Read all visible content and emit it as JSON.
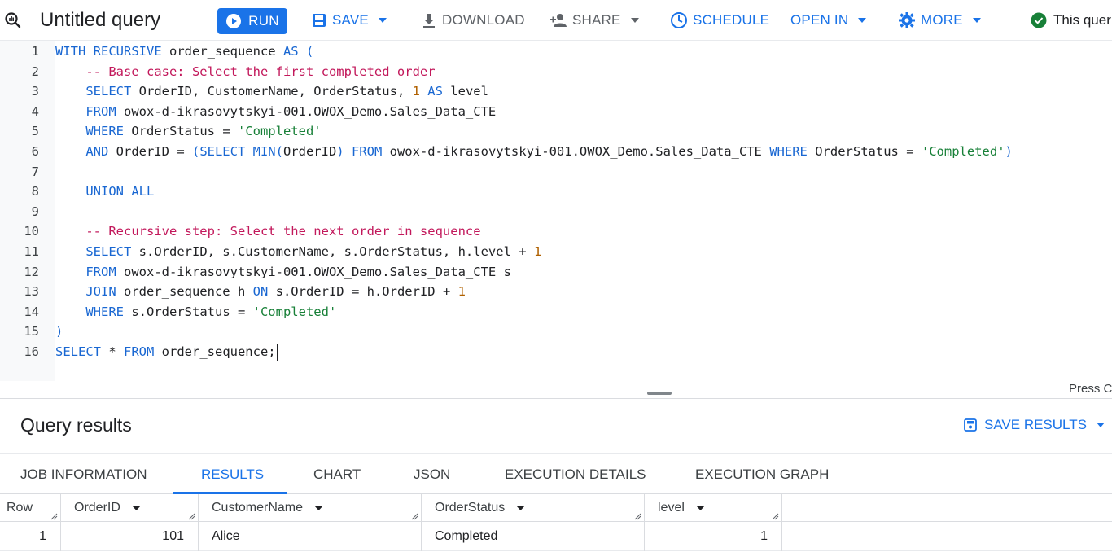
{
  "toolbar": {
    "title": "Untitled query",
    "run_label": "RUN",
    "save_label": "SAVE",
    "download_label": "DOWNLOAD",
    "share_label": "SHARE",
    "schedule_label": "SCHEDULE",
    "open_in_label": "OPEN IN",
    "more_label": "MORE",
    "status_text": "This quer",
    "accent_color": "#1a73e8",
    "status_color": "#188038"
  },
  "editor": {
    "line_numbers": [
      "1",
      "2",
      "3",
      "4",
      "5",
      "6",
      "7",
      "8",
      "9",
      "10",
      "11",
      "12",
      "13",
      "14",
      "15",
      "16"
    ],
    "lines": [
      [
        {
          "t": "WITH RECURSIVE",
          "c": "kw"
        },
        {
          "t": " order_sequence ",
          "c": ""
        },
        {
          "t": "AS (",
          "c": "kw"
        }
      ],
      [
        {
          "t": "    ",
          "c": ""
        },
        {
          "t": "-- Base case: Select the first completed order",
          "c": "cm"
        }
      ],
      [
        {
          "t": "    ",
          "c": ""
        },
        {
          "t": "SELECT",
          "c": "kw"
        },
        {
          "t": " OrderID, CustomerName, OrderStatus, ",
          "c": ""
        },
        {
          "t": "1",
          "c": "num"
        },
        {
          "t": " AS",
          "c": "kw"
        },
        {
          "t": " level",
          "c": ""
        }
      ],
      [
        {
          "t": "    ",
          "c": ""
        },
        {
          "t": "FROM",
          "c": "kw"
        },
        {
          "t": " owox-d-ikrasovytskyi-001.OWOX_Demo.Sales_Data_CTE",
          "c": ""
        }
      ],
      [
        {
          "t": "    ",
          "c": ""
        },
        {
          "t": "WHERE",
          "c": "kw"
        },
        {
          "t": " OrderStatus = ",
          "c": ""
        },
        {
          "t": "'Completed'",
          "c": "str"
        }
      ],
      [
        {
          "t": "    ",
          "c": ""
        },
        {
          "t": "AND",
          "c": "kw"
        },
        {
          "t": " OrderID = ",
          "c": ""
        },
        {
          "t": "(SELECT MIN(",
          "c": "kw"
        },
        {
          "t": "OrderID",
          "c": ""
        },
        {
          "t": ") FROM",
          "c": "kw"
        },
        {
          "t": " owox-d-ikrasovytskyi-001.OWOX_Demo.Sales_Data_CTE ",
          "c": ""
        },
        {
          "t": "WHERE",
          "c": "kw"
        },
        {
          "t": " OrderStatus = ",
          "c": ""
        },
        {
          "t": "'Completed'",
          "c": "str"
        },
        {
          "t": ")",
          "c": "kw"
        }
      ],
      [],
      [
        {
          "t": "    ",
          "c": ""
        },
        {
          "t": "UNION ALL",
          "c": "kw"
        }
      ],
      [],
      [
        {
          "t": "    ",
          "c": ""
        },
        {
          "t": "-- Recursive step: Select the next order in sequence",
          "c": "cm"
        }
      ],
      [
        {
          "t": "    ",
          "c": ""
        },
        {
          "t": "SELECT",
          "c": "kw"
        },
        {
          "t": " s.OrderID, s.CustomerName, s.OrderStatus, h.level + ",
          "c": ""
        },
        {
          "t": "1",
          "c": "num"
        }
      ],
      [
        {
          "t": "    ",
          "c": ""
        },
        {
          "t": "FROM",
          "c": "kw"
        },
        {
          "t": " owox-d-ikrasovytskyi-001.OWOX_Demo.Sales_Data_CTE s",
          "c": ""
        }
      ],
      [
        {
          "t": "    ",
          "c": ""
        },
        {
          "t": "JOIN",
          "c": "kw"
        },
        {
          "t": " order_sequence h ",
          "c": ""
        },
        {
          "t": "ON",
          "c": "kw"
        },
        {
          "t": " s.OrderID = h.OrderID + ",
          "c": ""
        },
        {
          "t": "1",
          "c": "num"
        }
      ],
      [
        {
          "t": "    ",
          "c": ""
        },
        {
          "t": "WHERE",
          "c": "kw"
        },
        {
          "t": " s.OrderStatus = ",
          "c": ""
        },
        {
          "t": "'Completed'",
          "c": "str"
        }
      ],
      [
        {
          "t": ")",
          "c": "kw"
        }
      ],
      [
        {
          "t": "SELECT",
          "c": "kw"
        },
        {
          "t": " * ",
          "c": ""
        },
        {
          "t": "FROM",
          "c": "kw"
        },
        {
          "t": " order_sequence;",
          "c": ""
        }
      ]
    ],
    "press_hint": "Press C"
  },
  "results": {
    "title": "Query results",
    "save_results_label": "SAVE RESULTS",
    "tabs": [
      "JOB INFORMATION",
      "RESULTS",
      "CHART",
      "JSON",
      "EXECUTION DETAILS",
      "EXECUTION GRAPH"
    ],
    "active_tab": "RESULTS",
    "columns": [
      "Row",
      "OrderID",
      "CustomerName",
      "OrderStatus",
      "level"
    ],
    "rows": [
      [
        "1",
        "101",
        "Alice",
        "Completed",
        "1"
      ]
    ]
  }
}
